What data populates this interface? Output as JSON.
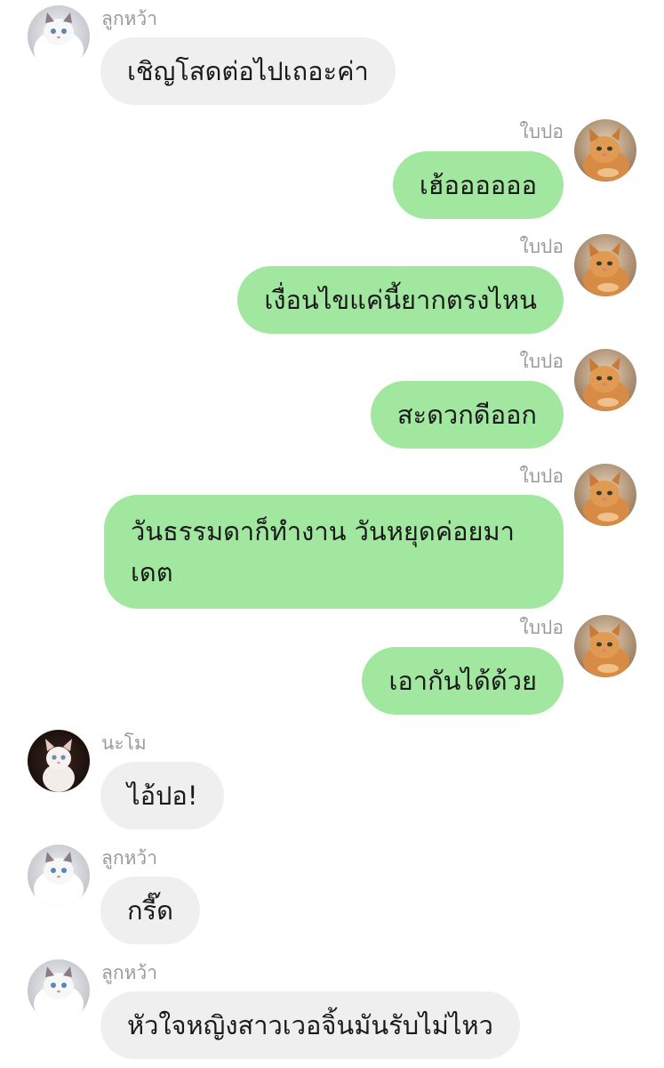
{
  "avatars": {
    "ruk_wa": "white-cat-avatar",
    "bai_por": "orange-kitten-avatar",
    "na_mo": "white-kitten-dark-bg-avatar"
  },
  "colors": {
    "incoming_bubble": "#efefef",
    "outgoing_bubble": "#a1e7a0",
    "sender_name": "#9a9a9a"
  },
  "messages": [
    {
      "sender": "ลูกหว้า",
      "text": "เชิญโสดต่อไปเถอะค่า",
      "direction": "incoming"
    },
    {
      "sender": "ใบปอ",
      "text": "เฮ้ออออออ",
      "direction": "outgoing"
    },
    {
      "sender": "ใบปอ",
      "text": "เงื่อนไขแค่นี้ยากตรงไหน",
      "direction": "outgoing"
    },
    {
      "sender": "ใบปอ",
      "text": "สะดวกดีออก",
      "direction": "outgoing"
    },
    {
      "sender": "ใบปอ",
      "text": "วันธรรมดาก็ทำงาน วันหยุดค่อยมาเดต",
      "direction": "outgoing"
    },
    {
      "sender": "ใบปอ",
      "text": "เอากันได้ด้วย",
      "direction": "outgoing"
    },
    {
      "sender": "นะโม",
      "text": "ไอ้ปอ!",
      "direction": "incoming"
    },
    {
      "sender": "ลูกหว้า",
      "text": "กรี๊ด",
      "direction": "incoming"
    },
    {
      "sender": "ลูกหว้า",
      "text": "หัวใจหญิงสาวเวอจิ้นมันรับไม่ไหว",
      "direction": "incoming"
    }
  ]
}
